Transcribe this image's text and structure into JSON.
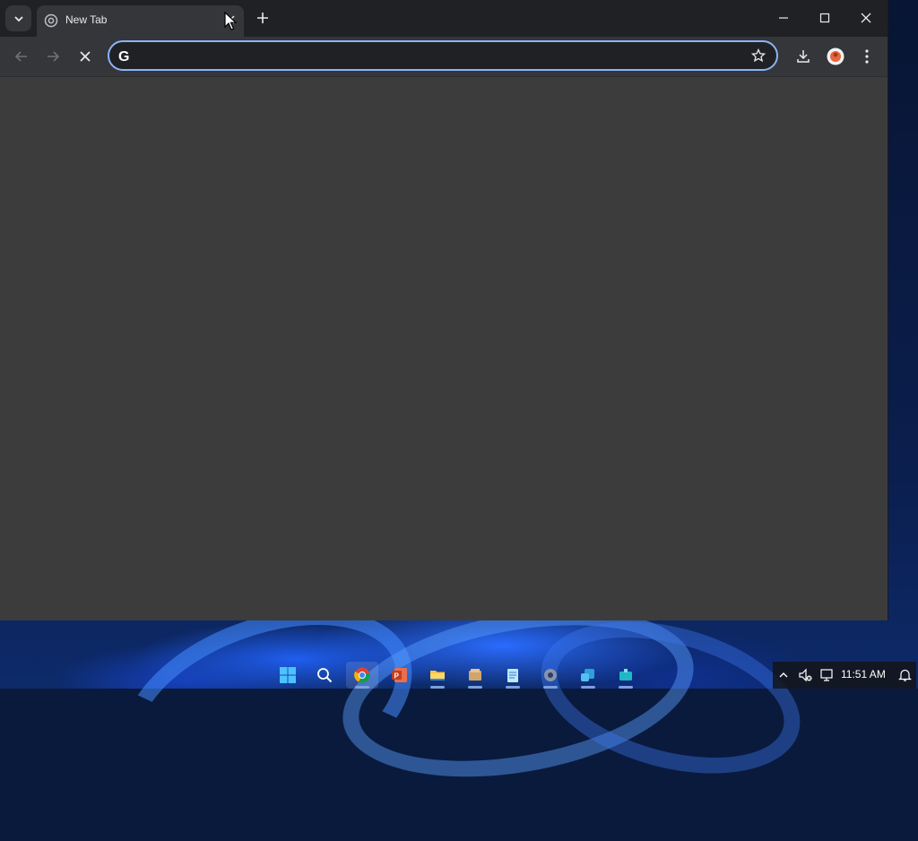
{
  "browser": {
    "tab": {
      "title": "New Tab",
      "favicon": "chrome-newtab-icon"
    },
    "omnibox": {
      "value": "",
      "placeholder": "",
      "search_engine_icon": "google-g-icon"
    },
    "colors": {
      "titlebar": "#202124",
      "toolbar": "#35363a",
      "content": "#3c3c3c",
      "omnibox_border": "#8ab4f8"
    },
    "icons": {
      "tab_search": "chevron-down-icon",
      "tab_close": "close-icon",
      "new_tab": "plus-icon",
      "back": "arrow-left-icon",
      "forward": "arrow-right-icon",
      "stop": "close-icon",
      "bookmark": "star-icon",
      "downloads": "download-icon",
      "profile": "avatar-icon",
      "menu": "kebab-menu-icon",
      "minimize": "minimize-icon",
      "maximize": "maximize-icon",
      "close_window": "close-icon"
    }
  },
  "taskbar": {
    "apps": [
      {
        "name": "start-icon"
      },
      {
        "name": "search-icon"
      },
      {
        "name": "chrome-icon",
        "active": true
      },
      {
        "name": "powerpoint-icon"
      },
      {
        "name": "file-explorer-icon"
      },
      {
        "name": "files-icon"
      },
      {
        "name": "notepad-icon"
      },
      {
        "name": "settings-icon"
      },
      {
        "name": "app-icon"
      },
      {
        "name": "app2-icon"
      }
    ],
    "tray": {
      "time": "11:51 AM",
      "icons": [
        "chevron-up-icon",
        "speaker-muted-icon",
        "network-icon",
        "notification-icon"
      ]
    }
  }
}
